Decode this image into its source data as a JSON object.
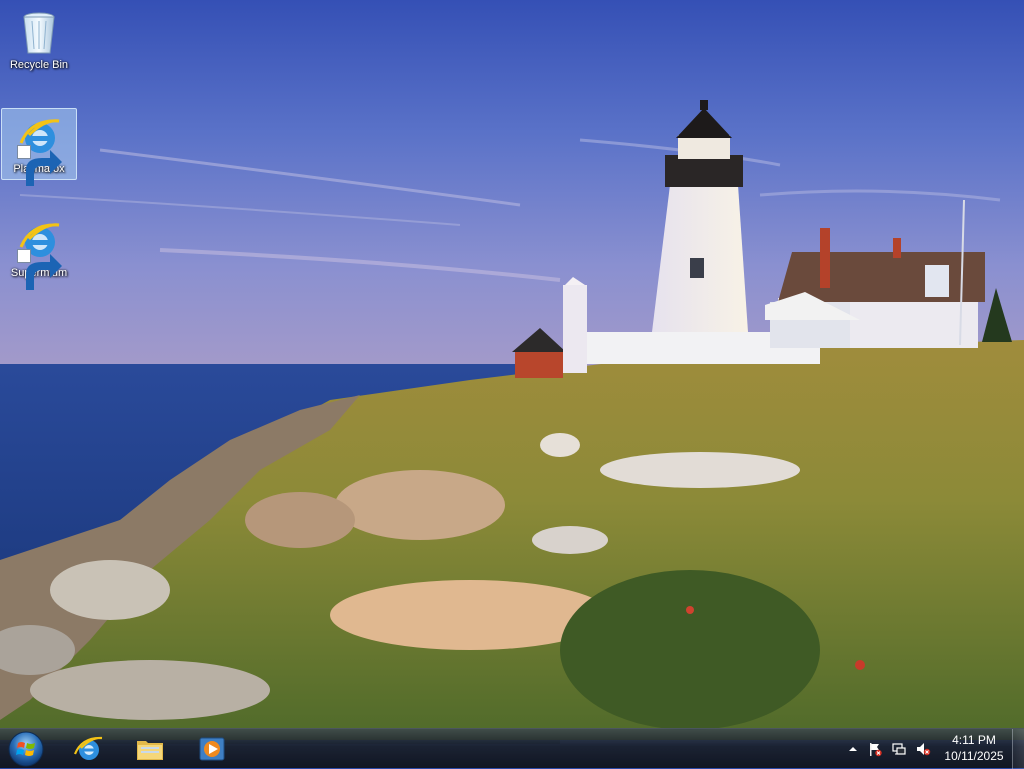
{
  "desktop": {
    "icons": [
      {
        "label": "Recycle Bin",
        "icon": "recycle-bin-icon"
      },
      {
        "label": "Plasmafox",
        "icon": "ie-browser-icon",
        "selected": true
      },
      {
        "label": "Supermium",
        "icon": "ie-browser-icon"
      }
    ]
  },
  "taskbar": {
    "start": {
      "icon": "windows-start-orb-icon"
    },
    "pinned": [
      {
        "icon": "internet-explorer-icon"
      },
      {
        "icon": "file-explorer-folder-icon"
      },
      {
        "icon": "media-player-icon"
      }
    ],
    "tray": {
      "icons": [
        "show-hidden-icons-chevron",
        "action-center-flag-icon",
        "network-icon",
        "volume-muted-icon"
      ],
      "time": "4:11 PM",
      "date": "10/11/2025"
    }
  },
  "colors": {
    "sky_top": "#3a54b8",
    "sea": "#203e8f",
    "grass": "#8a8a3a",
    "taskbar": "#1a1f26"
  }
}
